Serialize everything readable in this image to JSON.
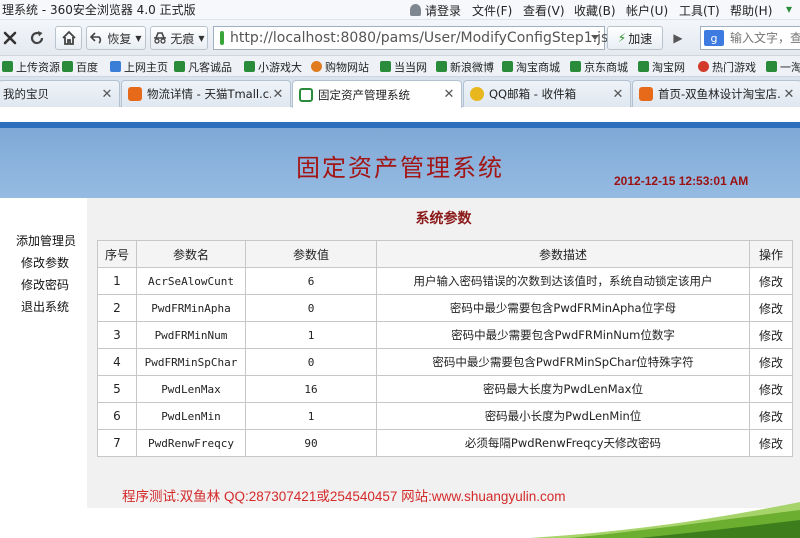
{
  "window": {
    "title": "理系统 - 360安全浏览器 4.0 正式版",
    "menu": {
      "login": "请登录",
      "file": "文件(F)",
      "view": "查看(V)",
      "favorites": "收藏(B)",
      "account": "帐户(U)",
      "tools": "工具(T)",
      "help": "帮助(H)"
    }
  },
  "navbar": {
    "restore_label": "恢复",
    "traceless_label": "无痕",
    "address_url": "http://localhost:8080/pams/User/ModifyConfigStep1.jsp",
    "accelerate_label": "加速",
    "search_engine_label": "g",
    "search_placeholder": "输入文字，查"
  },
  "bookmarks": [
    {
      "label": "上传资源",
      "icon_color": "#2a8c3a"
    },
    {
      "label": "百度",
      "icon_color": "#2a8c3a"
    },
    {
      "label": "上网主页",
      "icon_color": "#3b7ed8"
    },
    {
      "label": "凡客诚品",
      "icon_color": "#2a8c3a"
    },
    {
      "label": "小游戏大",
      "icon_color": "#2a8c3a"
    },
    {
      "label": "购物网站",
      "icon_color": "#e07b1f"
    },
    {
      "label": "当当网",
      "icon_color": "#2a8c3a"
    },
    {
      "label": "新浪微博",
      "icon_color": "#2a8c3a"
    },
    {
      "label": "淘宝商城",
      "icon_color": "#2a8c3a"
    },
    {
      "label": "京东商城",
      "icon_color": "#2a8c3a"
    },
    {
      "label": "淘宝网",
      "icon_color": "#2a8c3a"
    },
    {
      "label": "热门游戏",
      "icon_color": "#d23b2a"
    },
    {
      "label": "一淘",
      "icon_color": "#2a8c3a"
    }
  ],
  "tabs": [
    {
      "label": "我的宝贝",
      "icon_color": "#e66a1a",
      "active": false
    },
    {
      "label": "物流详情 - 天猫Tmall.c...",
      "icon_color": "#e66a1a",
      "active": false
    },
    {
      "label": "固定资产管理系统",
      "icon_color": "#2a8c3a",
      "active": true
    },
    {
      "label": "QQ邮箱 - 收件箱",
      "icon_color": "#e8b71e",
      "active": false
    },
    {
      "label": "首页-双鱼林设计淘宝店...",
      "icon_color": "#e66a1a",
      "active": false
    }
  ],
  "page": {
    "system_title": "固定资产管理系统",
    "datetime": "2012-12-15 12:53:01 AM",
    "sidebar": [
      {
        "label": "添加管理员"
      },
      {
        "label": "修改参数"
      },
      {
        "label": "修改密码"
      },
      {
        "label": "退出系统"
      }
    ],
    "section_title": "系统参数",
    "table": {
      "headers": [
        "序号",
        "参数名",
        "参数值",
        "参数描述",
        "操作"
      ],
      "rows": [
        {
          "no": "1",
          "name": "AcrSeAlowCunt",
          "value": "6",
          "desc": "用户输入密码错误的次数到达该值时，系统自动锁定该用户",
          "action": "修改"
        },
        {
          "no": "2",
          "name": "PwdFRMinApha",
          "value": "0",
          "desc": "密码中最少需要包含PwdFRMinApha位字母",
          "action": "修改"
        },
        {
          "no": "3",
          "name": "PwdFRMinNum",
          "value": "1",
          "desc": "密码中最少需要包含PwdFRMinNum位数字",
          "action": "修改"
        },
        {
          "no": "4",
          "name": "PwdFRMinSpChar",
          "value": "0",
          "desc": "密码中最少需要包含PwdFRMinSpChar位特殊字符",
          "action": "修改"
        },
        {
          "no": "5",
          "name": "PwdLenMax",
          "value": "16",
          "desc": "密码最大长度为PwdLenMax位",
          "action": "修改"
        },
        {
          "no": "6",
          "name": "PwdLenMin",
          "value": "1",
          "desc": "密码最小长度为PwdLenMin位",
          "action": "修改"
        },
        {
          "no": "7",
          "name": "PwdRenwFreqcy",
          "value": "90",
          "desc": "必须每隔PwdRenwFreqcy天修改密码",
          "action": "修改"
        }
      ]
    },
    "footer": "程序测试:双鱼林 QQ:287307421或254540457 网站:www.shuangyulin.com"
  },
  "colors": {
    "header_blue": "#8db4df",
    "title_red": "#a31515",
    "footer_red": "#d42a2a",
    "content_gray": "#f1f1f1"
  }
}
